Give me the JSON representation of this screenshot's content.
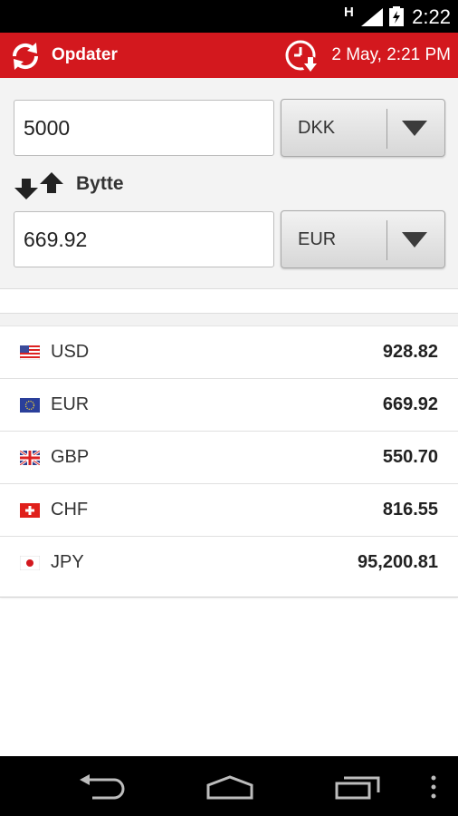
{
  "status_bar": {
    "network": "H",
    "time": "2:22"
  },
  "app_bar": {
    "refresh_label": "Opdater",
    "last_update": "2 May, 2:21 PM"
  },
  "converter": {
    "from": {
      "amount": "5000",
      "currency": "DKK"
    },
    "swap_label": "Bytte",
    "to": {
      "amount": "669.92",
      "currency": "EUR"
    }
  },
  "rates": [
    {
      "code": "USD",
      "value": "928.82",
      "flag": "us-flag-icon"
    },
    {
      "code": "EUR",
      "value": "669.92",
      "flag": "eu-flag-icon"
    },
    {
      "code": "GBP",
      "value": "550.70",
      "flag": "uk-flag-icon"
    },
    {
      "code": "CHF",
      "value": "816.55",
      "flag": "swiss-flag-icon"
    },
    {
      "code": "JPY",
      "value": "95,200.81",
      "flag": "japan-flag-icon"
    }
  ],
  "colors": {
    "accent": "#d3181e",
    "status_bar": "#000000"
  }
}
